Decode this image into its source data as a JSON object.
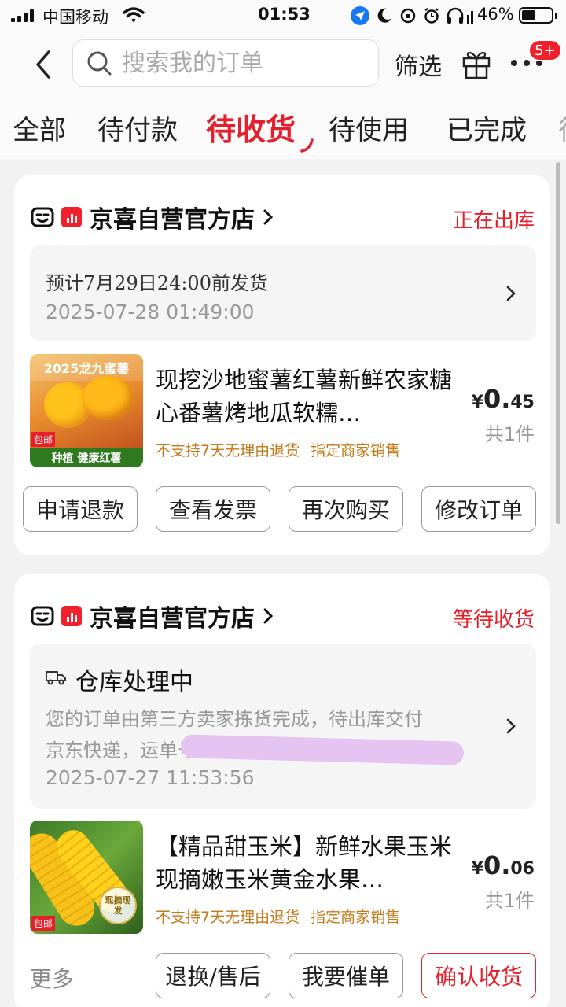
{
  "status_bar": {
    "carrier": "中国移动",
    "time": "01:53",
    "battery": "46%",
    "battery_level": 0.46
  },
  "header": {
    "search_placeholder": "搜索我的订单",
    "filter_label": "筛选",
    "badge": "5+"
  },
  "tabs": [
    {
      "label": "全部"
    },
    {
      "label": "待付款"
    },
    {
      "label": "待收货",
      "active": true
    },
    {
      "label": "待使用"
    },
    {
      "label": "已完成"
    },
    {
      "label": "待"
    }
  ],
  "orders": [
    {
      "store": "京喜自营官方店",
      "status": "正在出库",
      "info_line1": "预计7月29日24:00前发货",
      "info_time": "2025-07-28 01:49:00",
      "product": {
        "image_text_top": "2025龙九蜜薯",
        "image_text_bottom": "种植 健康红薯",
        "image_badge": "包邮",
        "title": "现挖沙地蜜薯红薯新鲜农家糖心番薯烤地瓜软糯…",
        "tags": [
          "不支持7天无理由退货",
          "指定商家销售"
        ],
        "price_currency": "¥",
        "price_int": "0.",
        "price_dec": "45",
        "qty": "共1件"
      },
      "buttons": [
        "申请退款",
        "查看发票",
        "再次购买",
        "修改订单"
      ]
    },
    {
      "store": "京喜自营官方店",
      "status": "等待收货",
      "wh_title": "仓库处理中",
      "wh_desc_line1": "您的订单由第三方卖家拣货完成，待出库交付",
      "wh_desc_line2": "京东快递，运单号为",
      "info_time": "2025-07-27 11:53:56",
      "product": {
        "image_badge": "包邮",
        "image_stamp": "现摘现发",
        "title": "【精品甜玉米】新鲜水果玉米现摘嫩玉米黄金水果…",
        "tags": [
          "不支持7天无理由退货",
          "指定商家销售"
        ],
        "price_currency": "¥",
        "price_int": "0.",
        "price_dec": "06",
        "qty": "共1件"
      },
      "more_label": "更多",
      "buttons": [
        "退换/售后",
        "我要催单",
        "确认收货"
      ]
    }
  ],
  "colors": {
    "accent_red": "#e3202b",
    "tag_orange": "#c27a1a"
  }
}
